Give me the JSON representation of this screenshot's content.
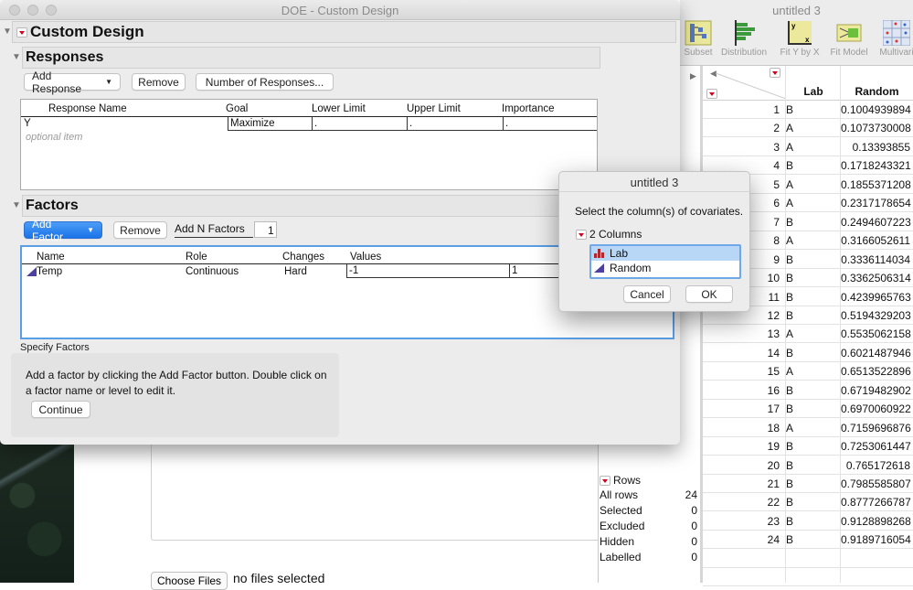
{
  "background": {
    "choose_files_label": "Choose Files",
    "no_files_text": "no files selected"
  },
  "doe_window": {
    "title": "DOE - Custom Design",
    "main_header": "Custom Design",
    "responses": {
      "header": "Responses",
      "buttons": {
        "add_response": "Add Response",
        "remove": "Remove",
        "number_of_responses": "Number of Responses..."
      },
      "columns": [
        "Response Name",
        "Goal",
        "Lower Limit",
        "Upper Limit",
        "Importance"
      ],
      "rows": [
        {
          "name": "Y",
          "goal": "Maximize",
          "lower": ".",
          "upper": ".",
          "importance": "."
        }
      ],
      "optional_hint": "optional item"
    },
    "factors": {
      "header": "Factors",
      "buttons": {
        "add_factor": "Add Factor",
        "remove": "Remove",
        "add_n_factors": "Add N Factors"
      },
      "add_n_value": "1",
      "columns": [
        "Name",
        "Role",
        "Changes",
        "Values"
      ],
      "rows": [
        {
          "name": "Temp",
          "role": "Continuous",
          "changes": "Hard",
          "low": "-1",
          "high": "1"
        }
      ]
    },
    "specify_factors": {
      "label": "Specify Factors",
      "instructions": "Add a factor by clicking the Add Factor button. Double click on a factor name or level to edit it.",
      "continue_label": "Continue"
    }
  },
  "data_table": {
    "title": "untitled 3",
    "toolbar": [
      "Subset",
      "Distribution",
      "Fit Y by X",
      "Fit Model",
      "Multivari"
    ],
    "columns": [
      "Lab",
      "Random"
    ],
    "rows": [
      [
        "1",
        "B",
        "0.1004939894"
      ],
      [
        "2",
        "A",
        "0.1073730008"
      ],
      [
        "3",
        "A",
        "0.13393855"
      ],
      [
        "4",
        "B",
        "0.1718243321"
      ],
      [
        "5",
        "A",
        "0.1855371208"
      ],
      [
        "6",
        "A",
        "0.2317178654"
      ],
      [
        "7",
        "B",
        "0.2494607223"
      ],
      [
        "8",
        "A",
        "0.3166052611"
      ],
      [
        "9",
        "B",
        "0.3336114034"
      ],
      [
        "10",
        "B",
        "0.3362506314"
      ],
      [
        "11",
        "B",
        "0.4239965763"
      ],
      [
        "12",
        "B",
        "0.5194329203"
      ],
      [
        "13",
        "A",
        "0.5535062158"
      ],
      [
        "14",
        "B",
        "0.6021487946"
      ],
      [
        "15",
        "A",
        "0.6513522896"
      ],
      [
        "16",
        "B",
        "0.6719482902"
      ],
      [
        "17",
        "B",
        "0.6970060922"
      ],
      [
        "18",
        "A",
        "0.7159696876"
      ],
      [
        "19",
        "B",
        "0.7253061447"
      ],
      [
        "20",
        "B",
        "0.765172618"
      ],
      [
        "21",
        "B",
        "0.7985585807"
      ],
      [
        "22",
        "B",
        "0.8777266787"
      ],
      [
        "23",
        "B",
        "0.9128898268"
      ],
      [
        "24",
        "B",
        "0.9189716054"
      ]
    ],
    "rows_panel": {
      "header": "Rows",
      "items": [
        {
          "label": "All rows",
          "value": "24"
        },
        {
          "label": "Selected",
          "value": "0"
        },
        {
          "label": "Excluded",
          "value": "0"
        },
        {
          "label": "Hidden",
          "value": "0"
        },
        {
          "label": "Labelled",
          "value": "0"
        }
      ]
    }
  },
  "dialog": {
    "title": "untitled 3",
    "prompt": "Select the column(s) of covariates.",
    "group_label": "2 Columns",
    "items": [
      {
        "label": "Lab",
        "icon": "nominal-bar-icon",
        "selected": true
      },
      {
        "label": "Random",
        "icon": "continuous-triangle-icon",
        "selected": false
      }
    ],
    "cancel_label": "Cancel",
    "ok_label": "OK"
  },
  "colors": {
    "accent_blue": "#1a73e8",
    "jmp_red": "#d0021b",
    "selection": "#b8d7f7"
  }
}
